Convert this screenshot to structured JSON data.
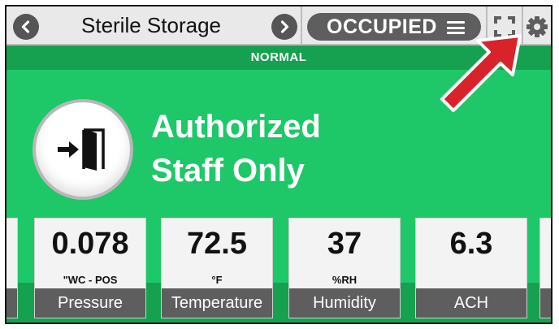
{
  "header": {
    "room_name": "Sterile Storage",
    "occupancy_status": "OCCUPIED",
    "icons": {
      "prev": "chevron-left-icon",
      "next": "chevron-right-icon",
      "menu": "menu-icon",
      "fullscreen": "fullscreen-icon",
      "settings": "gear-icon"
    }
  },
  "status_strip": {
    "label": "NORMAL"
  },
  "notice": {
    "line1": "Authorized",
    "line2": "Staff Only",
    "icon": "door-exit-icon"
  },
  "metrics": [
    {
      "value": "0.078",
      "unit": "\"WC - POS",
      "label": "Pressure"
    },
    {
      "value": "72.5",
      "unit": "°F",
      "label": "Temperature"
    },
    {
      "value": "37",
      "unit": "%RH",
      "label": "Humidity"
    },
    {
      "value": "6.3",
      "unit": "",
      "label": "ACH"
    }
  ],
  "colors": {
    "background_green": "#1ec868",
    "dark_green": "#15a14f",
    "pill_gray": "#5e5e5e",
    "annotation_red": "#d8232a"
  }
}
